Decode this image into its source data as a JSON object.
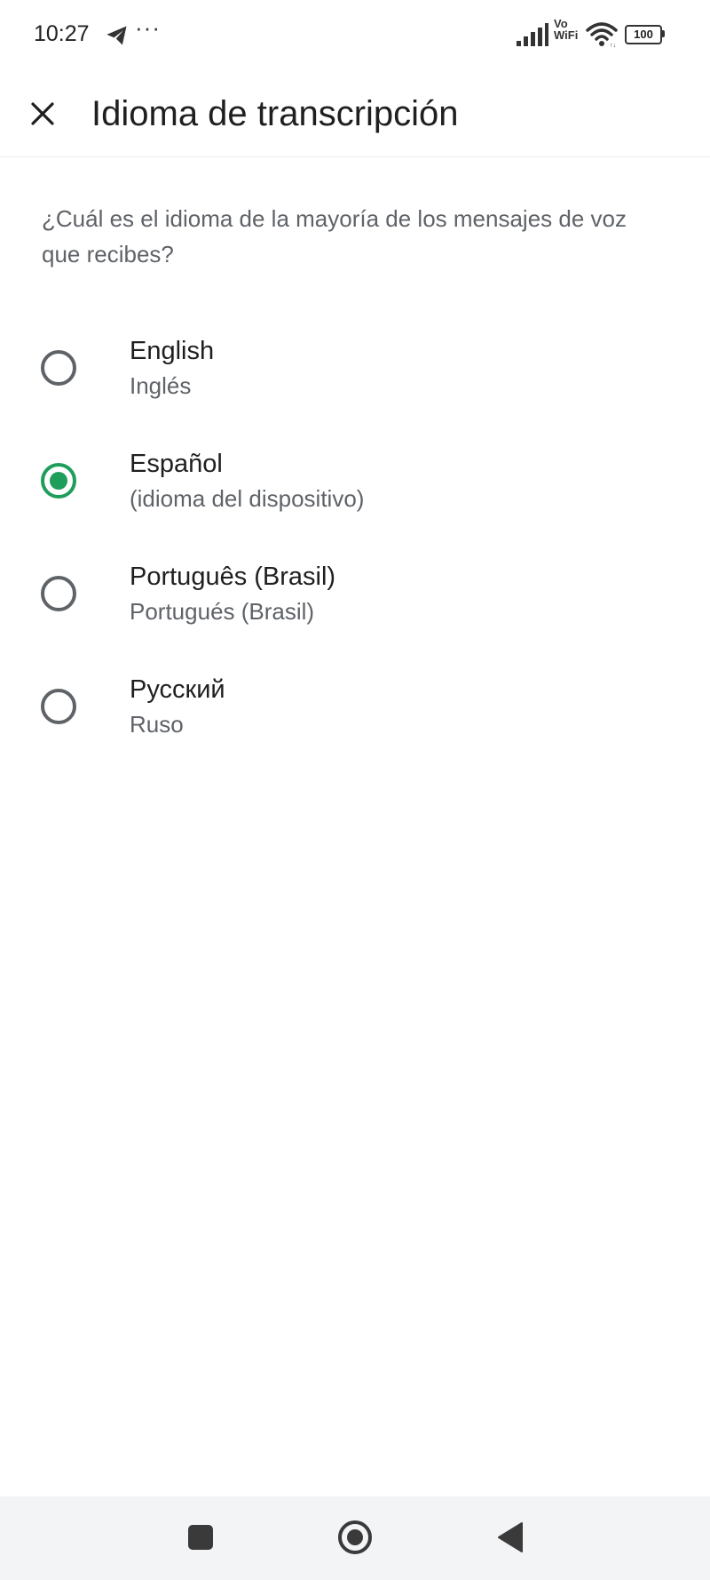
{
  "status_bar": {
    "time": "10:27",
    "more": "···",
    "vo": "Vo",
    "wifi_label": "WiFi",
    "battery": "100",
    "icons": [
      "telegram-icon",
      "signal-icon",
      "vowifi-icon",
      "wifi-icon",
      "battery-icon"
    ]
  },
  "header": {
    "title": "Idioma de transcripción",
    "close_icon": "close-icon"
  },
  "question": "¿Cuál es el idioma de la mayoría de los mensajes de voz que recibes?",
  "options": [
    {
      "label": "English",
      "sublabel": "Inglés",
      "selected": false
    },
    {
      "label": "Español",
      "sublabel": "(idioma del dispositivo)",
      "selected": true
    },
    {
      "label": "Português (Brasil)",
      "sublabel": "Portugués (Brasil)",
      "selected": false
    },
    {
      "label": "Русский",
      "sublabel": "Ruso",
      "selected": false
    }
  ],
  "colors": {
    "accent": "#1e9e5a",
    "text_primary": "#1f1f1f",
    "text_secondary": "#5f6368",
    "nav_background": "#f3f4f6"
  },
  "nav_bar": {
    "icons": [
      "recents-icon",
      "home-icon",
      "back-icon"
    ]
  }
}
